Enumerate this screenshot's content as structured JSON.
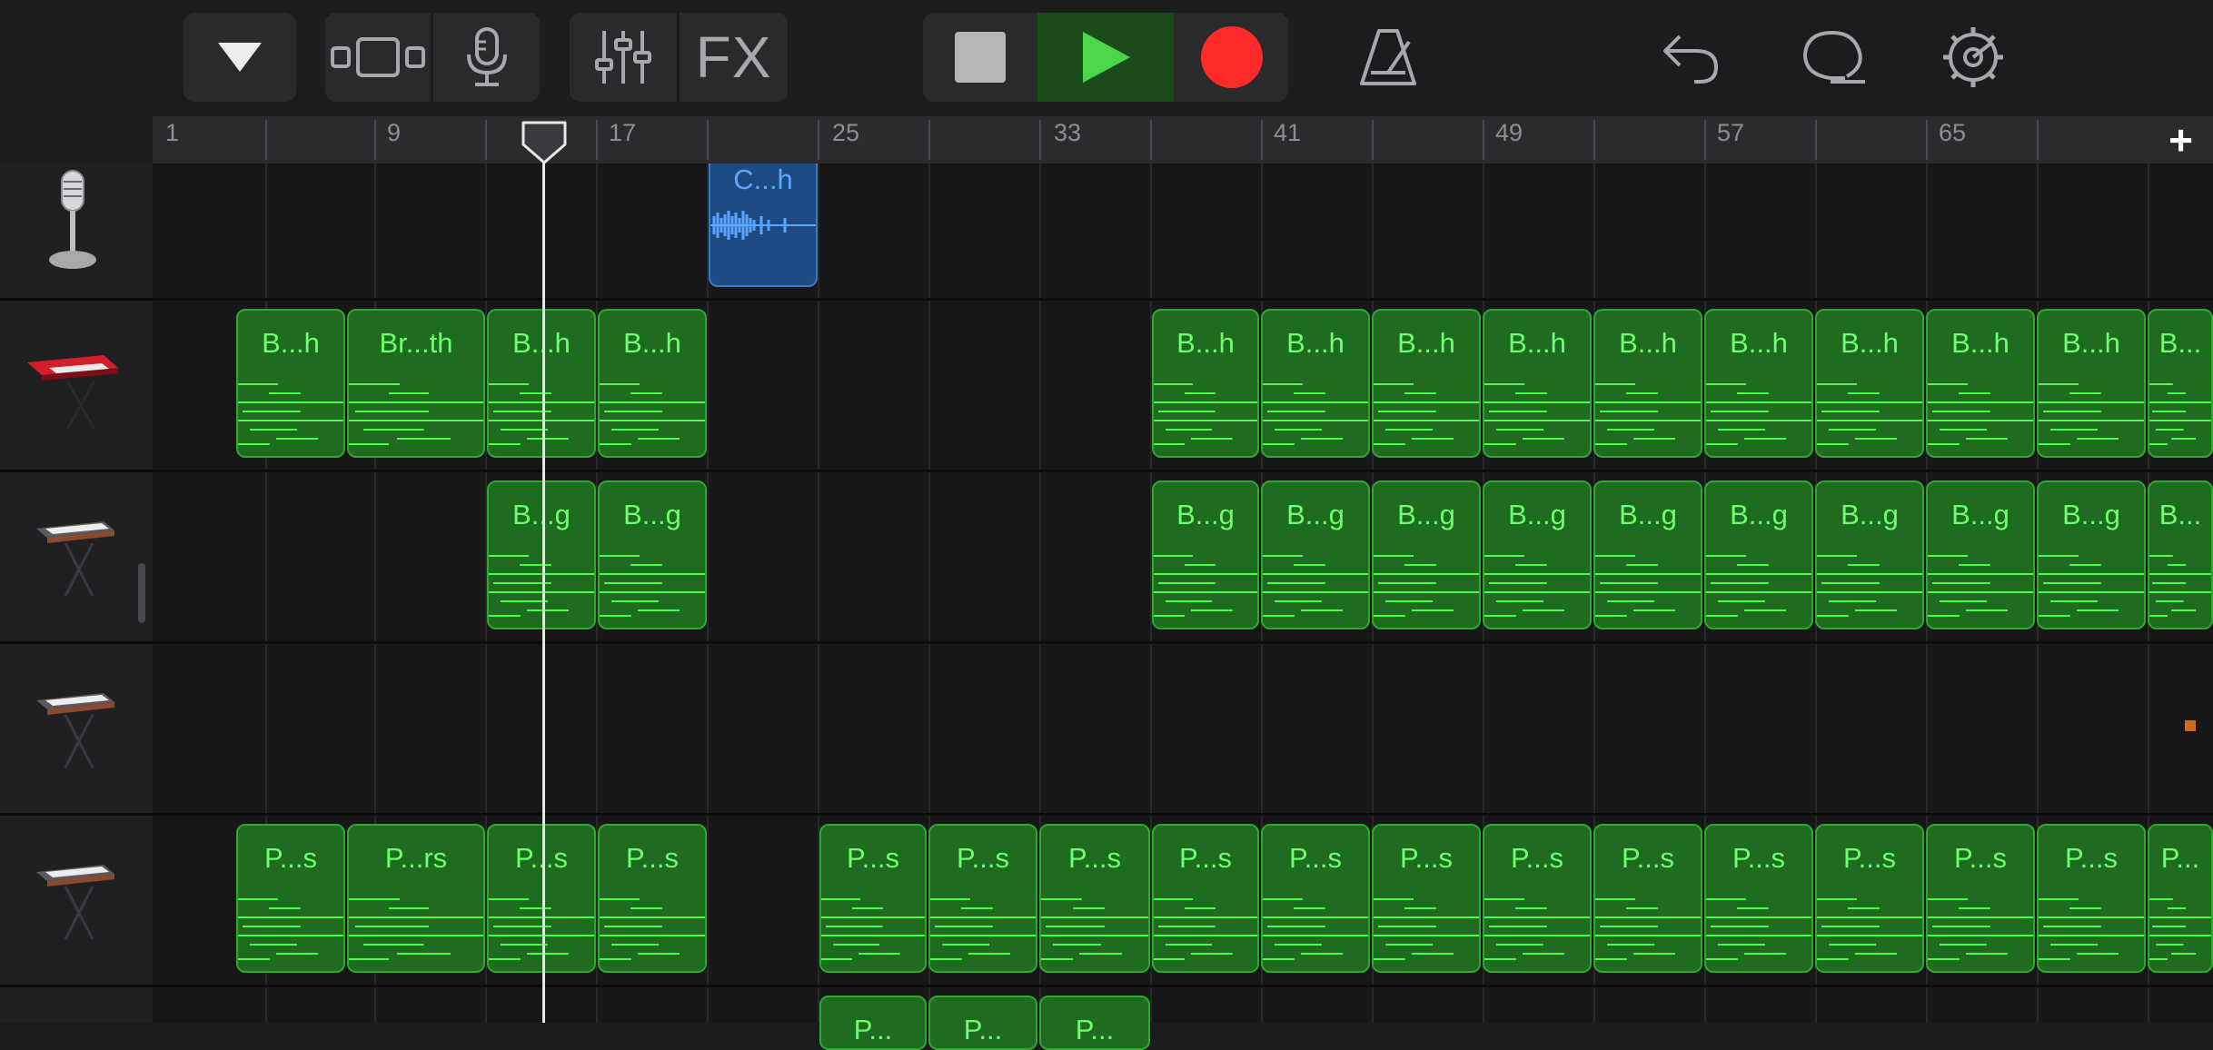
{
  "toolbar": {
    "buttons": [
      {
        "name": "browser-menu-button",
        "icon": "triangle-down-icon"
      },
      {
        "name": "tracks-view-button",
        "icon": "tracks-view-icon"
      },
      {
        "name": "instrument-mic-button",
        "icon": "microphone-icon"
      },
      {
        "name": "mixer-button",
        "icon": "sliders-icon"
      },
      {
        "name": "fx-button",
        "label": "FX"
      },
      {
        "name": "stop-button",
        "icon": "stop-icon"
      },
      {
        "name": "play-button",
        "icon": "play-icon"
      },
      {
        "name": "record-button",
        "icon": "record-icon"
      },
      {
        "name": "metronome-button",
        "icon": "metronome-icon"
      },
      {
        "name": "undo-button",
        "icon": "undo-icon"
      },
      {
        "name": "loop-browser-button",
        "icon": "loop-icon"
      },
      {
        "name": "settings-button",
        "icon": "gear-icon"
      }
    ],
    "fx_label": "FX"
  },
  "ruler": {
    "bars": [
      "1",
      "9",
      "17",
      "25",
      "33",
      "41",
      "49",
      "57",
      "65"
    ],
    "add_section_label": "+"
  },
  "tracks": [
    {
      "name": "audio-recorder",
      "icon": "microphone-icon"
    },
    {
      "name": "synth-red",
      "icon": "red-keyboard-icon"
    },
    {
      "name": "keyboard-2",
      "icon": "keyboard-stand-icon"
    },
    {
      "name": "keyboard-3",
      "icon": "keyboard-stand-icon"
    },
    {
      "name": "keyboard-4",
      "icon": "keyboard-stand-icon"
    }
  ],
  "regions": {
    "audio": "C...h",
    "track2": [
      "B...h",
      "Br...th",
      "B...h",
      "B...h",
      "B...h",
      "B...h",
      "B...h",
      "B...h",
      "B...h",
      "B...h",
      "B...h",
      "B...h",
      "B...h",
      "B..."
    ],
    "track3": [
      "B...g",
      "B...g",
      "B...g",
      "B...g",
      "B...g",
      "B...g",
      "B...g",
      "B...g",
      "B...g",
      "B...g",
      "B..."
    ],
    "track5": [
      "P...s",
      "P...rs",
      "P...s",
      "P...s",
      "P...s",
      "P...s",
      "P...s",
      "P...s",
      "P...s",
      "P...s",
      "P...s",
      "P...s",
      "P...s",
      "P...s",
      "P...s",
      "P..."
    ],
    "track6": [
      "P...",
      "P...",
      "P..."
    ]
  },
  "colors": {
    "midi_region": "#1f6b1f",
    "midi_text": "#6dff6d",
    "audio_region": "#1d4a82",
    "play_active": "#4cd64c",
    "record": "#ff2a2a"
  }
}
